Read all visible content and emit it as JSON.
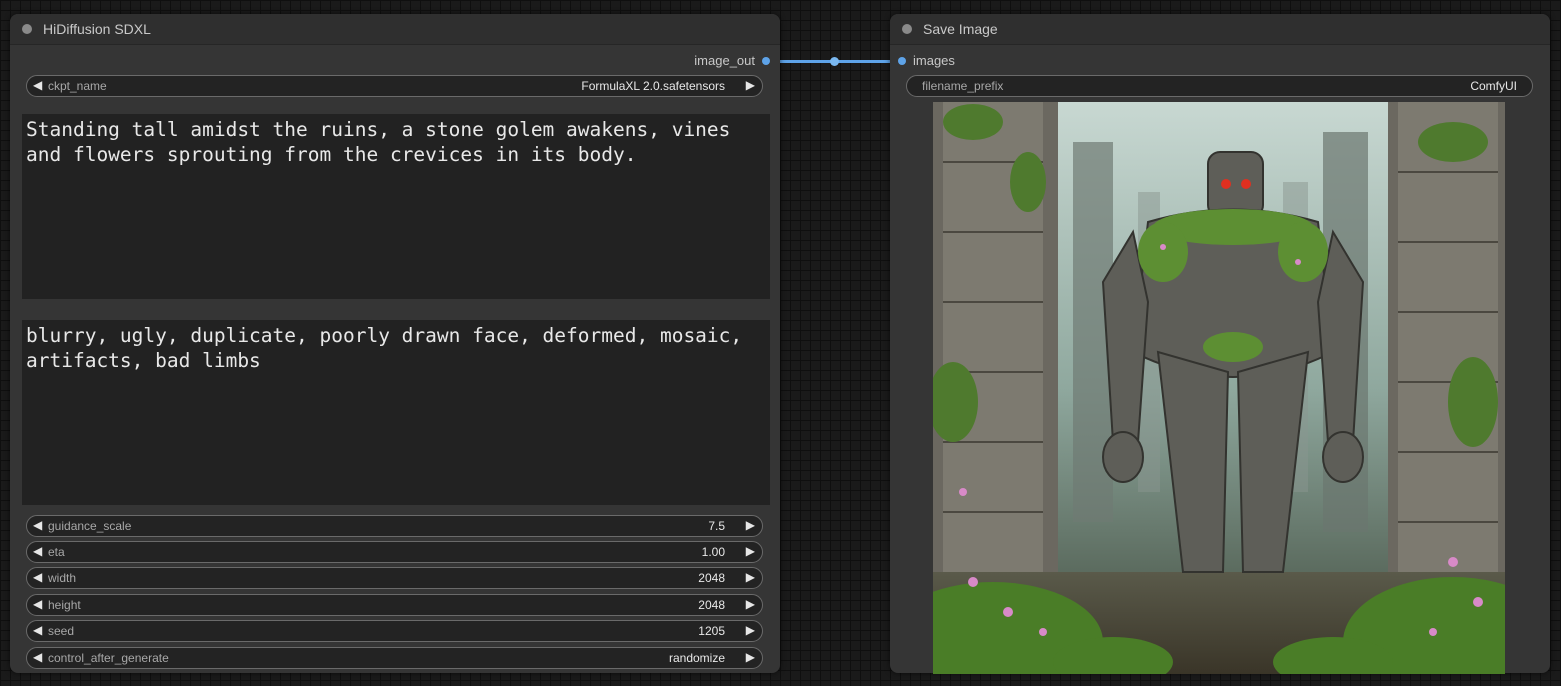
{
  "node1": {
    "title": "HiDiffusion SDXL",
    "output_label": "image_out",
    "ckpt": {
      "label": "ckpt_name",
      "value": "FormulaXL 2.0.safetensors"
    },
    "positive_prompt": "Standing tall amidst the ruins, a stone golem awakens, vines and flowers sprouting from the crevices in its body.",
    "negative_prompt": "blurry, ugly, duplicate, poorly drawn face, deformed, mosaic, artifacts, bad limbs",
    "widgets": [
      {
        "label": "guidance_scale",
        "value": "7.5"
      },
      {
        "label": "eta",
        "value": "1.00"
      },
      {
        "label": "width",
        "value": "2048"
      },
      {
        "label": "height",
        "value": "2048"
      },
      {
        "label": "seed",
        "value": "1205"
      },
      {
        "label": "control_after_generate",
        "value": "randomize"
      }
    ]
  },
  "node2": {
    "title": "Save Image",
    "input_label": "images",
    "filename_prefix": {
      "label": "filename_prefix",
      "value": "ComfyUI"
    }
  },
  "icons": {
    "left_arrow": "◀",
    "right_arrow": "▶"
  },
  "colors": {
    "link": "#5ea3e8",
    "node_bg": "#353535",
    "canvas_bg": "#1a1a1a"
  }
}
